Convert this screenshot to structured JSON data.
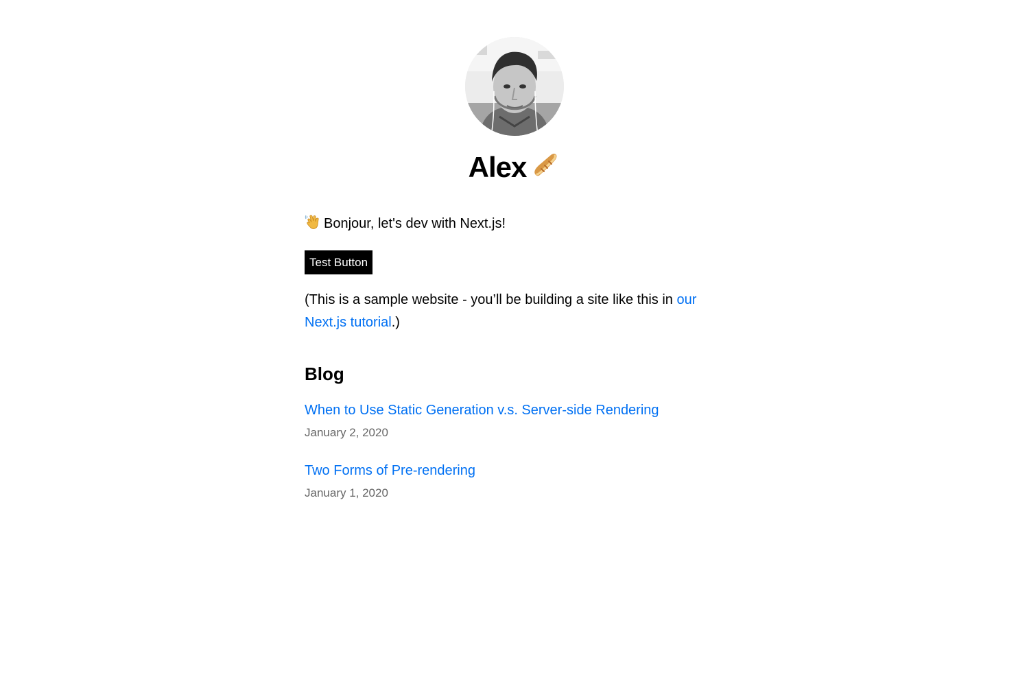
{
  "profile": {
    "name": "Alex",
    "name_icon": "baguette-bread-icon",
    "avatar": "profile-photo"
  },
  "intro": {
    "icon": "waving-hand-icon",
    "text": "Bonjour, let's dev with Next.js!"
  },
  "test_button": {
    "label": "Test Button"
  },
  "note": {
    "prefix": "(This is a sample website - you’ll be building a site like this in ",
    "link_text": "our Next.js tutorial",
    "suffix": ".)"
  },
  "blog": {
    "heading": "Blog",
    "posts": [
      {
        "title": "When to Use Static Generation v.s. Server-side Rendering",
        "date": "January 2, 2020"
      },
      {
        "title": "Two Forms of Pre-rendering",
        "date": "January 1, 2020"
      }
    ]
  },
  "colors": {
    "link": "#0070f3",
    "date": "#666666",
    "button_background": "#000000",
    "button_text": "#ffffff"
  }
}
